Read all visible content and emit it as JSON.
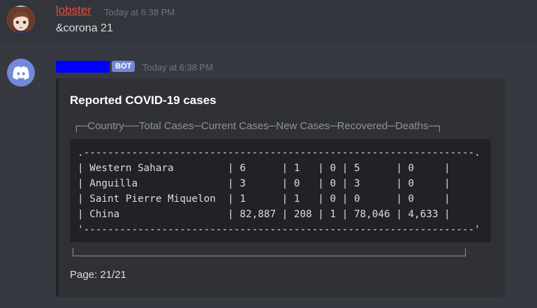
{
  "message1": {
    "author": "lobster",
    "timestamp": "Today at 6:38 PM",
    "content": "&corona 21"
  },
  "message2": {
    "bot_tag": "BOT",
    "timestamp": "Today at 6:38 PM",
    "embed": {
      "title": "Reported COVID-19 cases",
      "header": "┌─Country──Total Cases─Current Cases─New Cases─Recovered─Deaths─┐",
      "table_text": ".-----------------------------------------------------------------.\n| Western Sahara         | 6      | 1   | 0 | 5      | 0     |\n| Anguilla               | 3      | 0   | 0 | 3      | 0     |\n| Saint Pierre Miquelon  | 1      | 1   | 0 | 0      | 0     |\n| China                  | 82,887 | 208 | 1 | 78,046 | 4,633 |\n'-----------------------------------------------------------------'",
      "table": {
        "columns": [
          "Country",
          "Total Cases",
          "Current Cases",
          "New Cases",
          "Recovered",
          "Deaths"
        ],
        "rows": [
          [
            "Western Sahara",
            "6",
            "1",
            "0",
            "5",
            "0"
          ],
          [
            "Anguilla",
            "3",
            "0",
            "0",
            "3",
            "0"
          ],
          [
            "Saint Pierre Miquelon",
            "1",
            "1",
            "0",
            "0",
            "0"
          ],
          [
            "China",
            "82,887",
            "208",
            "1",
            "78,046",
            "4,633"
          ]
        ]
      },
      "page": "Page: 21/21"
    }
  },
  "colors": {
    "username": "#e74c3c",
    "bot_tag": "#7289da",
    "redaction": "#0000ff",
    "discord_blurple": "#7289da"
  },
  "icons": {
    "user_avatar": "anime-character-avatar",
    "bot_avatar": "discord-logo-icon"
  }
}
